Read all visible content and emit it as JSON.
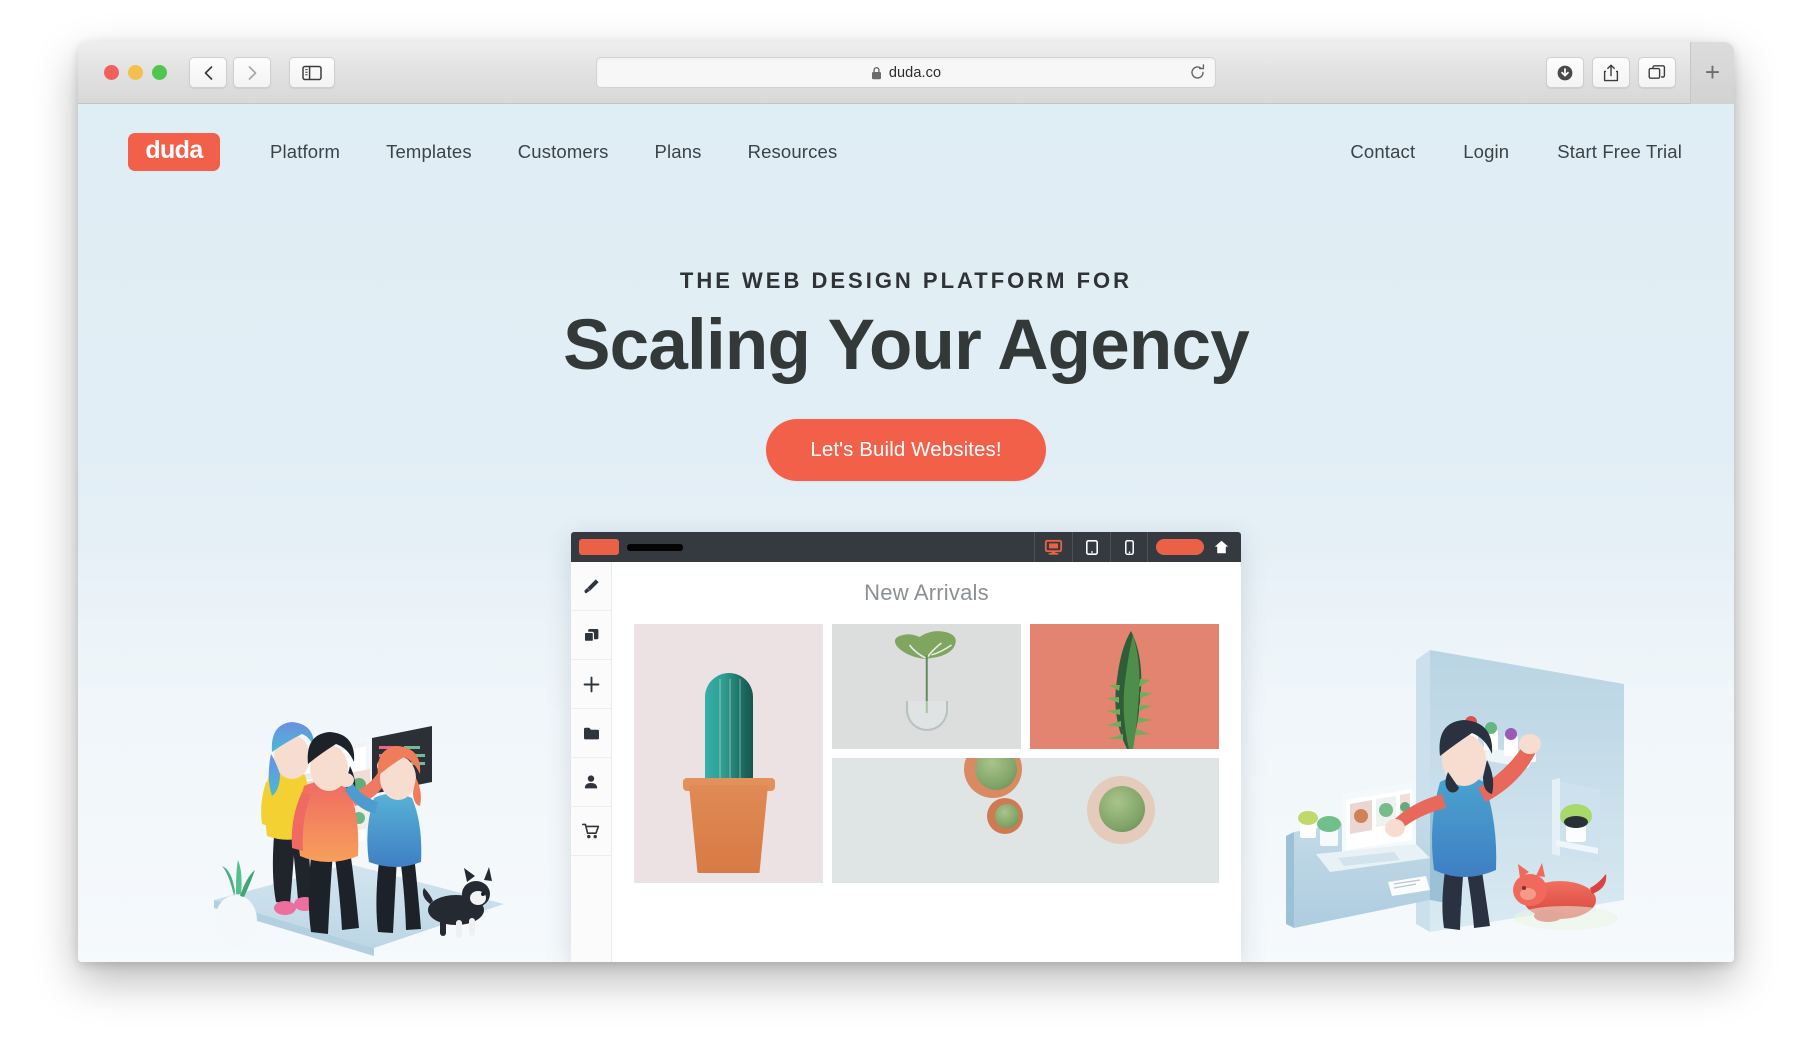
{
  "browser": {
    "traffic_lights": [
      "close",
      "minimize",
      "zoom"
    ],
    "back_label": "Back",
    "forward_label": "Forward",
    "sidebar_label": "Show Sidebar",
    "url": "duda.co",
    "url_secure": true,
    "reload_label": "Reload",
    "downloads_label": "Downloads",
    "share_label": "Share",
    "tab_overview_label": "Tab Overview",
    "new_tab_label": "+"
  },
  "site": {
    "logo_text": "duda",
    "nav_primary": [
      {
        "label": "Platform"
      },
      {
        "label": "Templates"
      },
      {
        "label": "Customers"
      },
      {
        "label": "Plans"
      },
      {
        "label": "Resources"
      }
    ],
    "nav_secondary": [
      {
        "label": "Contact"
      },
      {
        "label": "Login"
      },
      {
        "label": "Start Free Trial"
      }
    ]
  },
  "hero": {
    "eyebrow": "THE WEB DESIGN PLATFORM FOR",
    "headline": "Scaling Your Agency",
    "cta_label": "Let's Build Websites!"
  },
  "builder_mockup": {
    "devices": [
      "desktop",
      "tablet",
      "mobile"
    ],
    "active_device": "desktop",
    "sidebar_icons": [
      "brush-icon",
      "layers-icon",
      "plus-icon",
      "folder-icon",
      "person-icon",
      "cart-icon"
    ],
    "canvas_title": "New Arrivals",
    "products": [
      {
        "name": "cactus-in-terracotta-pot"
      },
      {
        "name": "monstera-leaf-in-glass-vase"
      },
      {
        "name": "green-plant-on-coral"
      },
      {
        "name": "succulents-flat-lay"
      }
    ]
  },
  "colors": {
    "brand_orange": "#f2604a",
    "hero_bg": "#e2eef5",
    "headline": "#333838",
    "nav_text": "#3b4349",
    "builder_bar": "#343a40"
  }
}
